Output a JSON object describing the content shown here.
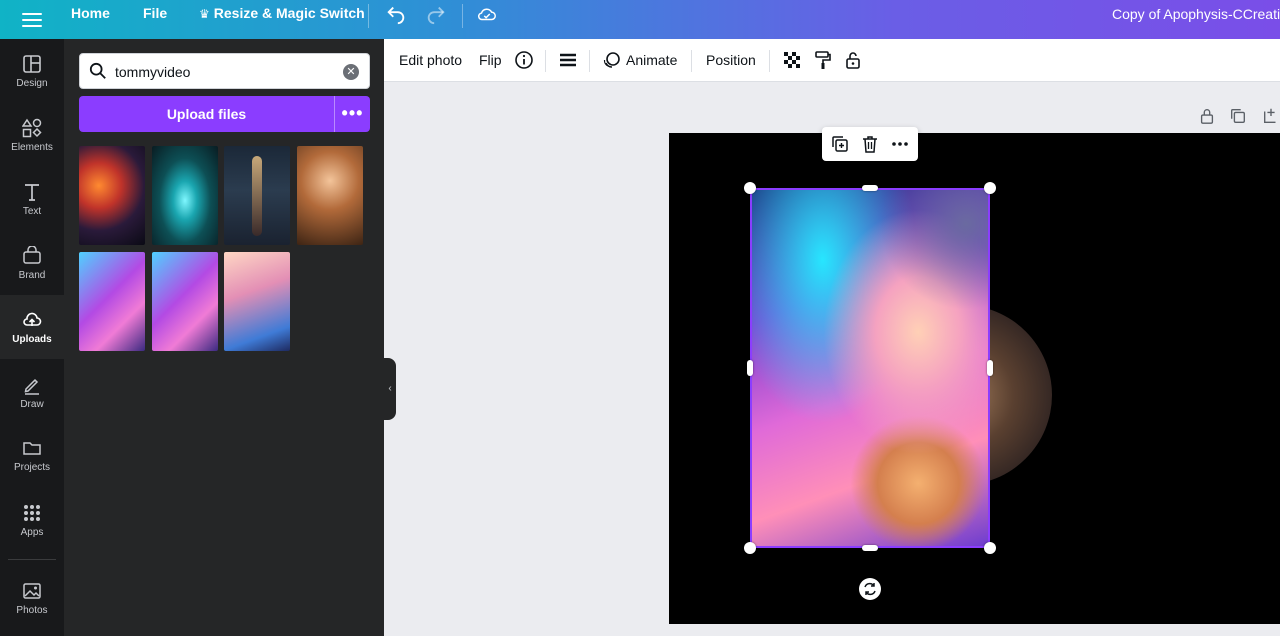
{
  "topbar": {
    "home": "Home",
    "file": "File",
    "resize": "Resize & Magic Switch",
    "title": "Copy of Apophysis-CCreatio"
  },
  "rail": {
    "items": [
      {
        "label": "Design",
        "icon": "layout-icon"
      },
      {
        "label": "Elements",
        "icon": "shapes-icon"
      },
      {
        "label": "Text",
        "icon": "text-icon"
      },
      {
        "label": "Brand",
        "icon": "brand-icon"
      },
      {
        "label": "Uploads",
        "icon": "cloud-upload-icon",
        "active": true
      },
      {
        "label": "Draw",
        "icon": "pen-icon"
      },
      {
        "label": "Projects",
        "icon": "folder-icon"
      },
      {
        "label": "Apps",
        "icon": "grid-icon"
      },
      {
        "label": "Photos",
        "icon": "image-icon"
      }
    ]
  },
  "panel": {
    "search_value": "tommyvideo",
    "upload_label": "Upload files",
    "more_label": "•••"
  },
  "toolbar": {
    "edit_photo": "Edit photo",
    "flip": "Flip",
    "animate": "Animate",
    "position": "Position"
  },
  "colors": {
    "accent": "#8b3dff",
    "rail_bg": "#18191b",
    "panel_bg": "#252627",
    "canvas_bg": "#000000"
  }
}
